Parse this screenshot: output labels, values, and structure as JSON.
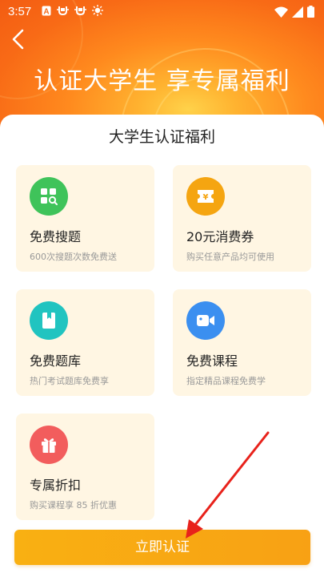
{
  "status_bar": {
    "time": "3:57",
    "left_icons": [
      "a-icon",
      "bug-icon",
      "bug-icon",
      "sun-icon"
    ],
    "right_icons": [
      "wifi-icon",
      "signal-icon",
      "battery-icon"
    ]
  },
  "header": {
    "title": "认证大学生 享专属福利"
  },
  "section": {
    "title": "大学生认证福利"
  },
  "benefits": [
    {
      "name": "免费搜题",
      "desc": "600次搜题次数免费送",
      "icon": "search-grid-icon",
      "color": "#3fc35a"
    },
    {
      "name": "20元消费券",
      "desc": "购买任意产品均可使用",
      "icon": "ticket-icon",
      "color": "#f5a511"
    },
    {
      "name": "免费题库",
      "desc": "热门考试题库免费享",
      "icon": "book-icon",
      "color": "#21c4c0"
    },
    {
      "name": "免费课程",
      "desc": "指定精品课程免费学",
      "icon": "video-camera-icon",
      "color": "#3b8ff0"
    },
    {
      "name": "专属折扣",
      "desc": "购买课程享 85 折优惠",
      "icon": "gift-icon",
      "color": "#f25d5d"
    }
  ],
  "cta": {
    "label": "立即认证"
  },
  "colors": {
    "accent": "#f9ad13",
    "hero": "#f86a16",
    "card_bg": "#fff6e3",
    "annotation_arrow": "#e8221b"
  }
}
